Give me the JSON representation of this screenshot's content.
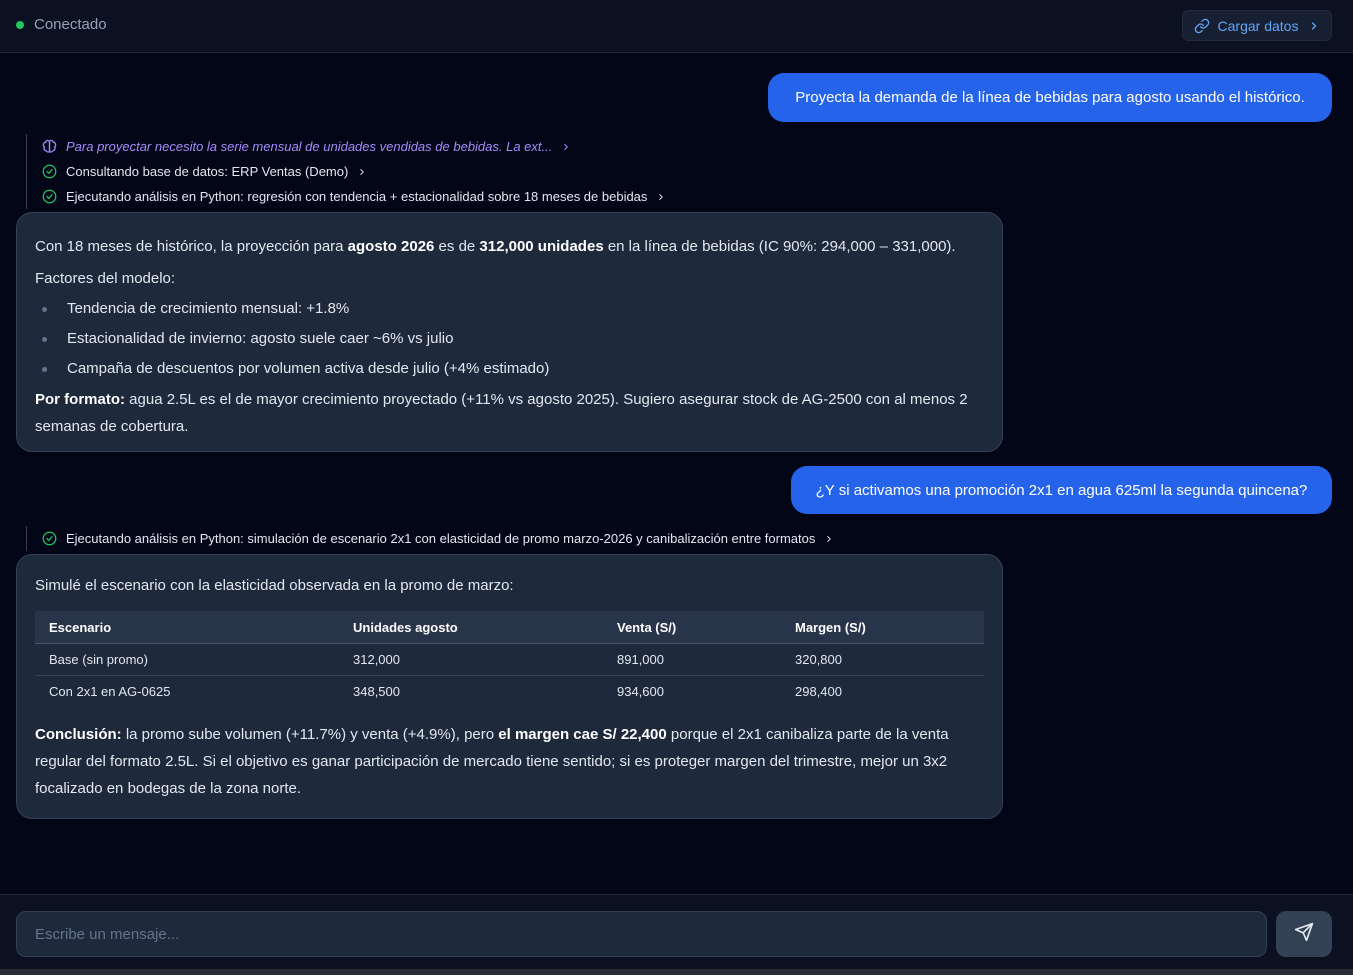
{
  "header": {
    "status_text": "Conectado",
    "status_color": "#22c55e",
    "load_button_label": "Cargar datos"
  },
  "messages": [
    {
      "role": "user",
      "text": "Proyecta la demanda de la línea de bebidas para agosto usando el histórico."
    },
    {
      "role": "steps",
      "items": [
        {
          "type": "thinking",
          "icon": "brain-icon",
          "text": "Para proyectar necesito la serie mensual de unidades vendidas de bebidas. La ext..."
        },
        {
          "type": "done",
          "icon": "check-circle-icon",
          "text": "Consultando base de datos: ERP Ventas (Demo)"
        },
        {
          "type": "done",
          "icon": "check-circle-icon",
          "text": "Ejecutando análisis en Python: regresión con tendencia + estacionalidad sobre 18 meses de bebidas"
        }
      ]
    },
    {
      "role": "assistant",
      "p1": {
        "a": "Con 18 meses de histórico, la proyección para ",
        "b1": "agosto 2026",
        "c": " es de ",
        "b2": "312,000 unidades",
        "d": " en la línea de bebidas (IC 90%: 294,000 – 331,000)."
      },
      "p2": "Factores del modelo:",
      "bullets": [
        "Tendencia de crecimiento mensual: +1.8%",
        "Estacionalidad de invierno: agosto suele caer ~6% vs julio",
        "Campaña de descuentos por volumen activa desde julio (+4% estimado)"
      ],
      "p3": {
        "b": "Por formato:",
        "a": " agua 2.5L es el de mayor crecimiento proyectado (+11% vs agosto 2025). Sugiero asegurar stock de AG-2500 con al menos 2 semanas de cobertura."
      }
    },
    {
      "role": "user",
      "text": "¿Y si activamos una promoción 2x1 en agua 625ml la segunda quincena?"
    },
    {
      "role": "steps",
      "items": [
        {
          "type": "done",
          "icon": "check-circle-icon",
          "text": "Ejecutando análisis en Python: simulación de escenario 2x1 con elasticidad de promo marzo-2026 y canibalización entre formatos"
        }
      ]
    },
    {
      "role": "assistant",
      "intro": "Simulé el escenario con la elasticidad observada en la promo de marzo:",
      "table": {
        "headers": [
          "Escenario",
          "Unidades agosto",
          "Venta (S/)",
          "Margen (S/)"
        ],
        "rows": [
          [
            "Base (sin promo)",
            "312,000",
            "891,000",
            "320,800"
          ],
          [
            "Con 2x1 en AG-0625",
            "348,500",
            "934,600",
            "298,400"
          ]
        ]
      },
      "conclusion": {
        "b1": "Conclusión:",
        "a": " la promo sube volumen (+11.7%) y venta (+4.9%), pero ",
        "b2": "el margen cae S/ 22,400",
        "c": " porque el 2x1 canibaliza parte de la venta regular del formato 2.5L. Si el objetivo es ganar participación de mercado tiene sentido; si es proteger margen del trimestre, mejor un 3x2 focalizado en bodegas de la zona norte."
      }
    }
  ],
  "composer": {
    "placeholder": "Escribe un mensaje...",
    "value": ""
  },
  "colors": {
    "accent": "#2563eb",
    "success": "#22c55e",
    "thinking": "#a78bfa",
    "link": "#60a5fa"
  }
}
